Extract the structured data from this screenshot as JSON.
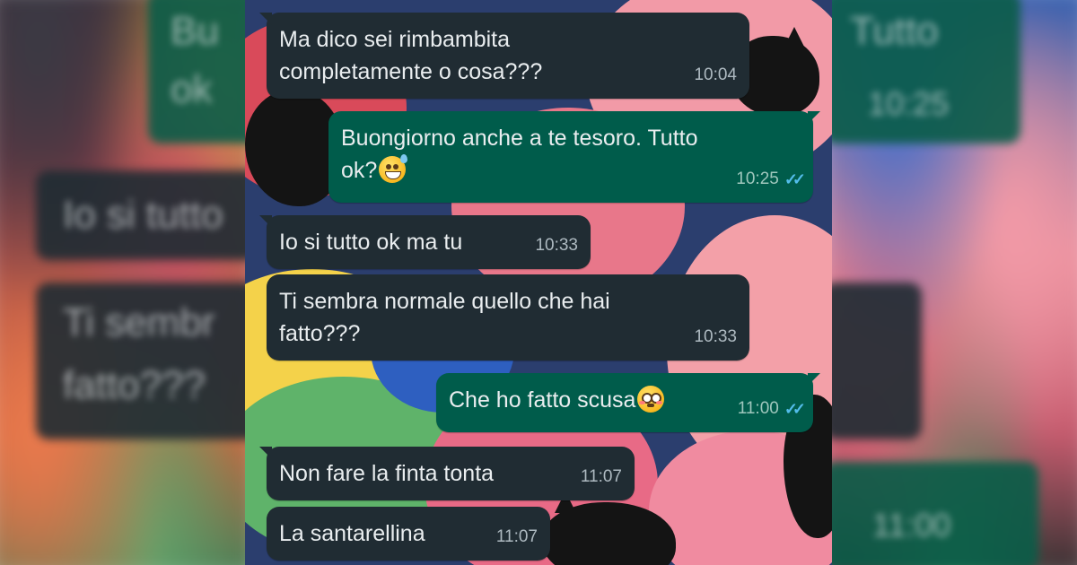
{
  "messages": [
    {
      "direction": "in",
      "text": "Ma dico sei rimbambita\ncompletamente o cosa???",
      "time": "10:04"
    },
    {
      "direction": "out",
      "text": "Buongiorno anche a te tesoro. Tutto\nok?",
      "emoji": "sweat-smile-emoji",
      "time": "10:25",
      "status": "read"
    },
    {
      "direction": "in",
      "text": "Io si tutto ok ma tu",
      "time": "10:33"
    },
    {
      "direction": "in",
      "text": "Ti sembra normale quello che hai\nfatto???",
      "time": "10:33"
    },
    {
      "direction": "out",
      "text": "Che ho fatto scusa",
      "emoji": "flushed-face-emoji",
      "time": "11:00",
      "status": "read"
    },
    {
      "direction": "in",
      "text": "Non fare la finta tonta",
      "time": "11:07"
    },
    {
      "direction": "in",
      "text": "La santarellina",
      "time": "11:07"
    }
  ],
  "theme": {
    "incoming_bubble": "#202c33",
    "outgoing_bubble": "#005c4b",
    "read_ticks": "#53bdeb"
  }
}
